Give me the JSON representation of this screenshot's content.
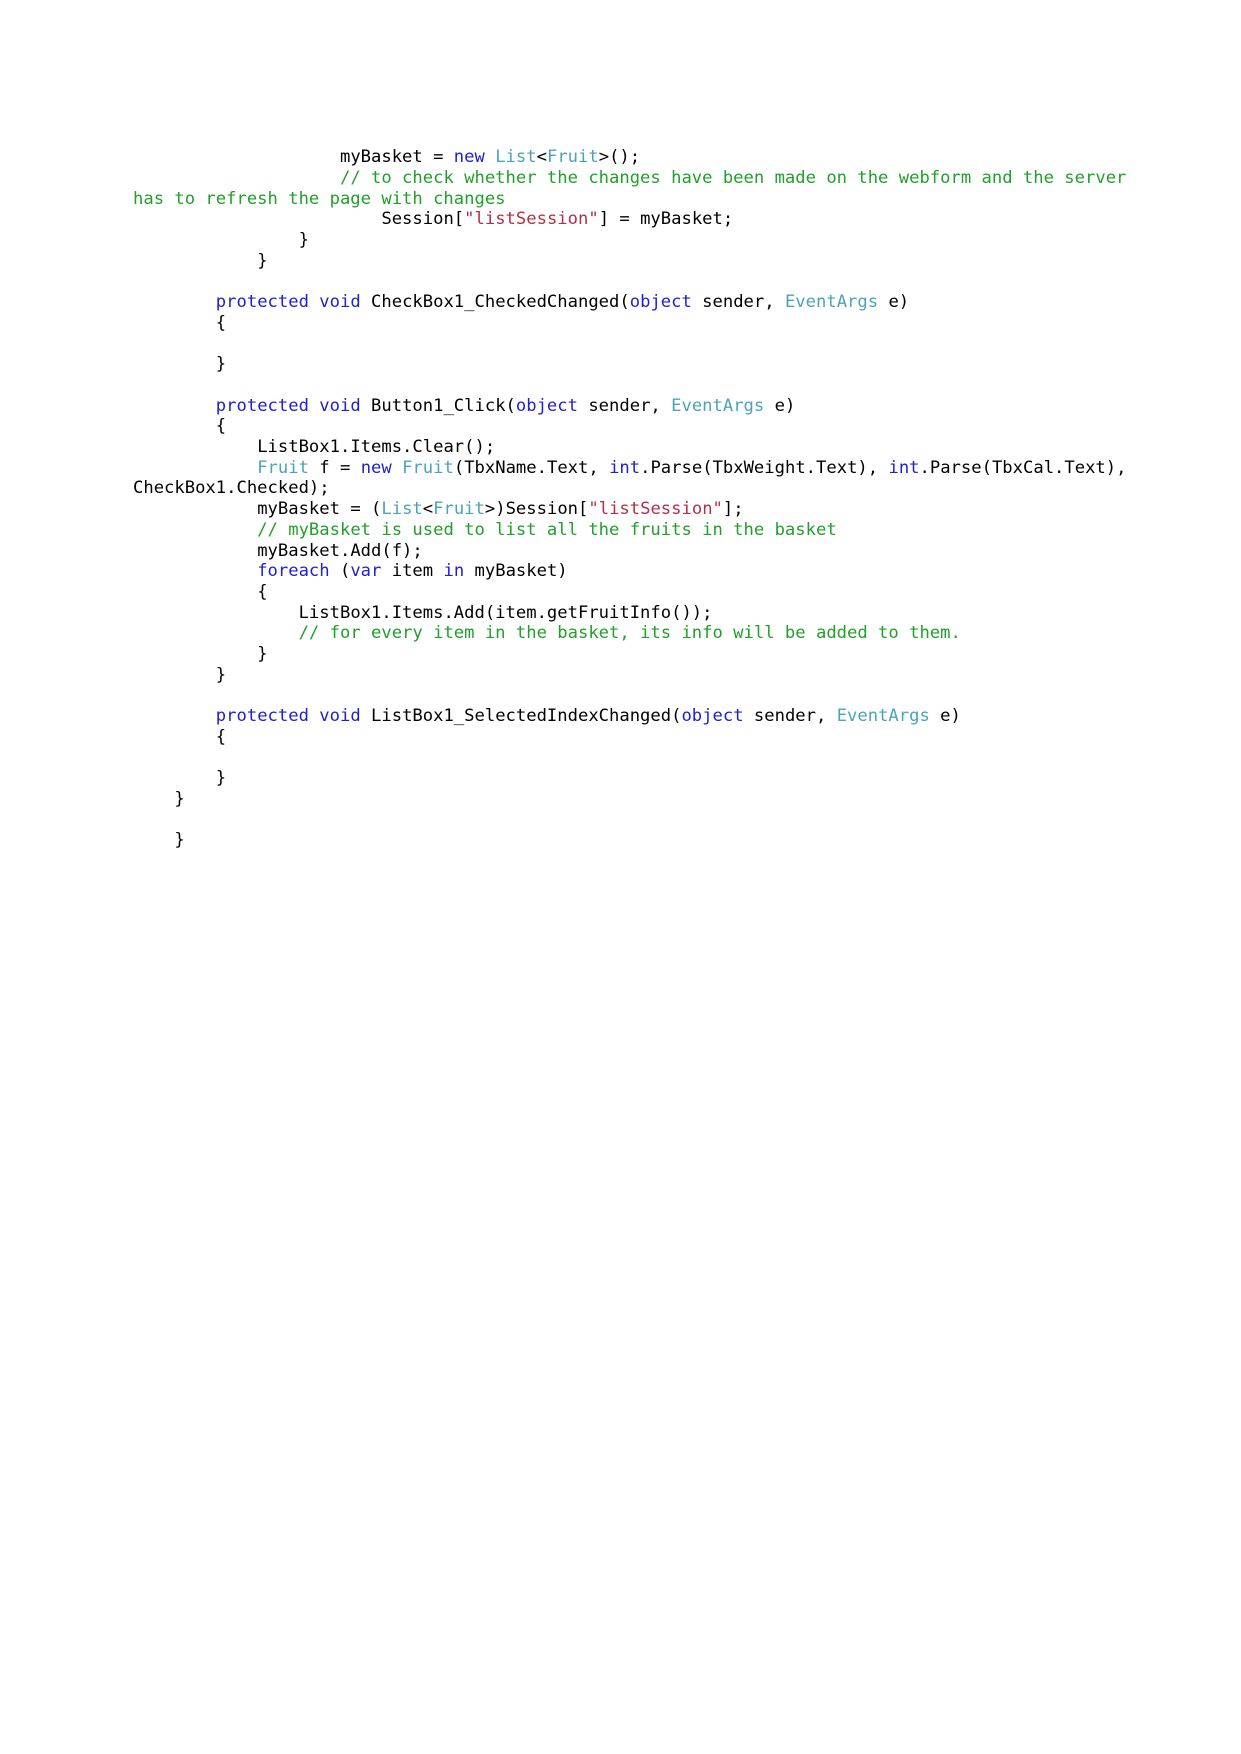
{
  "document": {
    "type": "code-listing",
    "language": "csharp",
    "page_background": "#ffffff",
    "colors": {
      "keyword": "#2020d0",
      "type": "#4ba3b8",
      "comment": "#21a02b",
      "string": "#b03048",
      "plain": "#000000"
    },
    "lines": [
      {
        "id": "line-1",
        "tokens": [
          {
            "t": "                    myBasket = ",
            "c": "pl"
          },
          {
            "t": "new",
            "c": "kw"
          },
          {
            "t": " ",
            "c": "pl"
          },
          {
            "t": "List",
            "c": "type"
          },
          {
            "t": "<",
            "c": "pl"
          },
          {
            "t": "Fruit",
            "c": "type"
          },
          {
            "t": ">();",
            "c": "pl"
          }
        ]
      },
      {
        "id": "line-2",
        "tokens": [
          {
            "t": "                    ",
            "c": "pl"
          },
          {
            "t": "// to check whether the changes have been made on the webform and the server has to refresh the page with changes",
            "c": "cmt"
          }
        ]
      },
      {
        "id": "line-3",
        "tokens": [
          {
            "t": "                        Session[",
            "c": "pl"
          },
          {
            "t": "\"listSession\"",
            "c": "str"
          },
          {
            "t": "] = myBasket;",
            "c": "pl"
          }
        ]
      },
      {
        "id": "line-4",
        "tokens": [
          {
            "t": "                }",
            "c": "pl"
          }
        ]
      },
      {
        "id": "line-5",
        "tokens": [
          {
            "t": "            }",
            "c": "pl"
          }
        ]
      },
      {
        "id": "line-6",
        "tokens": [
          {
            "t": " ",
            "c": "pl"
          }
        ]
      },
      {
        "id": "line-7",
        "tokens": [
          {
            "t": "        ",
            "c": "pl"
          },
          {
            "t": "protected void",
            "c": "kw"
          },
          {
            "t": " CheckBox1_CheckedChanged(",
            "c": "pl"
          },
          {
            "t": "object",
            "c": "kw"
          },
          {
            "t": " sender, ",
            "c": "pl"
          },
          {
            "t": "EventArgs",
            "c": "type"
          },
          {
            "t": " e)",
            "c": "pl"
          }
        ]
      },
      {
        "id": "line-8",
        "tokens": [
          {
            "t": "        {",
            "c": "pl"
          }
        ]
      },
      {
        "id": "line-9",
        "tokens": [
          {
            "t": " ",
            "c": "pl"
          }
        ]
      },
      {
        "id": "line-10",
        "tokens": [
          {
            "t": "        }",
            "c": "pl"
          }
        ]
      },
      {
        "id": "line-11",
        "tokens": [
          {
            "t": " ",
            "c": "pl"
          }
        ]
      },
      {
        "id": "line-12",
        "tokens": [
          {
            "t": "        ",
            "c": "pl"
          },
          {
            "t": "protected void",
            "c": "kw"
          },
          {
            "t": " Button1_Click(",
            "c": "pl"
          },
          {
            "t": "object",
            "c": "kw"
          },
          {
            "t": " sender, ",
            "c": "pl"
          },
          {
            "t": "EventArgs",
            "c": "type"
          },
          {
            "t": " e)",
            "c": "pl"
          }
        ]
      },
      {
        "id": "line-13",
        "tokens": [
          {
            "t": "        {",
            "c": "pl"
          }
        ]
      },
      {
        "id": "line-14",
        "tokens": [
          {
            "t": "            ListBox1.Items.Clear();",
            "c": "pl"
          }
        ]
      },
      {
        "id": "line-15",
        "tokens": [
          {
            "t": "            ",
            "c": "pl"
          },
          {
            "t": "Fruit",
            "c": "type"
          },
          {
            "t": " f = ",
            "c": "pl"
          },
          {
            "t": "new",
            "c": "kw"
          },
          {
            "t": " ",
            "c": "pl"
          },
          {
            "t": "Fruit",
            "c": "type"
          },
          {
            "t": "(TbxName.Text, ",
            "c": "pl"
          },
          {
            "t": "int",
            "c": "kw"
          },
          {
            "t": ".Parse(TbxWeight.Text), ",
            "c": "pl"
          },
          {
            "t": "int",
            "c": "kw"
          },
          {
            "t": ".Parse(TbxCal.Text), CheckBox1.Checked);",
            "c": "pl"
          }
        ]
      },
      {
        "id": "line-16",
        "tokens": [
          {
            "t": "            myBasket = (",
            "c": "pl"
          },
          {
            "t": "List",
            "c": "type"
          },
          {
            "t": "<",
            "c": "pl"
          },
          {
            "t": "Fruit",
            "c": "type"
          },
          {
            "t": ">)Session[",
            "c": "pl"
          },
          {
            "t": "\"listSession\"",
            "c": "str"
          },
          {
            "t": "];",
            "c": "pl"
          }
        ]
      },
      {
        "id": "line-17",
        "tokens": [
          {
            "t": "            ",
            "c": "pl"
          },
          {
            "t": "// myBasket is used to list all the fruits in the basket",
            "c": "cmt"
          }
        ]
      },
      {
        "id": "line-18",
        "tokens": [
          {
            "t": "            myBasket.Add(f);",
            "c": "pl"
          }
        ]
      },
      {
        "id": "line-19",
        "tokens": [
          {
            "t": "            ",
            "c": "pl"
          },
          {
            "t": "foreach",
            "c": "kw"
          },
          {
            "t": " (",
            "c": "pl"
          },
          {
            "t": "var",
            "c": "kw"
          },
          {
            "t": " item ",
            "c": "pl"
          },
          {
            "t": "in",
            "c": "kw"
          },
          {
            "t": " myBasket)",
            "c": "pl"
          }
        ]
      },
      {
        "id": "line-20",
        "tokens": [
          {
            "t": "            {",
            "c": "pl"
          }
        ]
      },
      {
        "id": "line-21",
        "tokens": [
          {
            "t": "                ListBox1.Items.Add(item.getFruitInfo());",
            "c": "pl"
          }
        ]
      },
      {
        "id": "line-22",
        "tokens": [
          {
            "t": "                ",
            "c": "pl"
          },
          {
            "t": "// for every item in the basket, its info will be added to them.",
            "c": "cmt"
          }
        ]
      },
      {
        "id": "line-23",
        "tokens": [
          {
            "t": "            }",
            "c": "pl"
          }
        ]
      },
      {
        "id": "line-24",
        "tokens": [
          {
            "t": "        }",
            "c": "pl"
          }
        ]
      },
      {
        "id": "line-25",
        "tokens": [
          {
            "t": " ",
            "c": "pl"
          }
        ]
      },
      {
        "id": "line-26",
        "tokens": [
          {
            "t": "        ",
            "c": "pl"
          },
          {
            "t": "protected void",
            "c": "kw"
          },
          {
            "t": " ListBox1_SelectedIndexChanged(",
            "c": "pl"
          },
          {
            "t": "object",
            "c": "kw"
          },
          {
            "t": " sender, ",
            "c": "pl"
          },
          {
            "t": "EventArgs",
            "c": "type"
          },
          {
            "t": " e)",
            "c": "pl"
          }
        ]
      },
      {
        "id": "line-27",
        "tokens": [
          {
            "t": "        {",
            "c": "pl"
          }
        ]
      },
      {
        "id": "line-28",
        "tokens": [
          {
            "t": " ",
            "c": "pl"
          }
        ]
      },
      {
        "id": "line-29",
        "tokens": [
          {
            "t": "        }",
            "c": "pl"
          }
        ]
      },
      {
        "id": "line-30",
        "tokens": [
          {
            "t": "    }",
            "c": "pl"
          }
        ]
      },
      {
        "id": "line-31",
        "tokens": [
          {
            "t": " ",
            "c": "pl"
          }
        ]
      },
      {
        "id": "line-32",
        "tokens": [
          {
            "t": "    }",
            "c": "pl"
          }
        ]
      }
    ]
  }
}
